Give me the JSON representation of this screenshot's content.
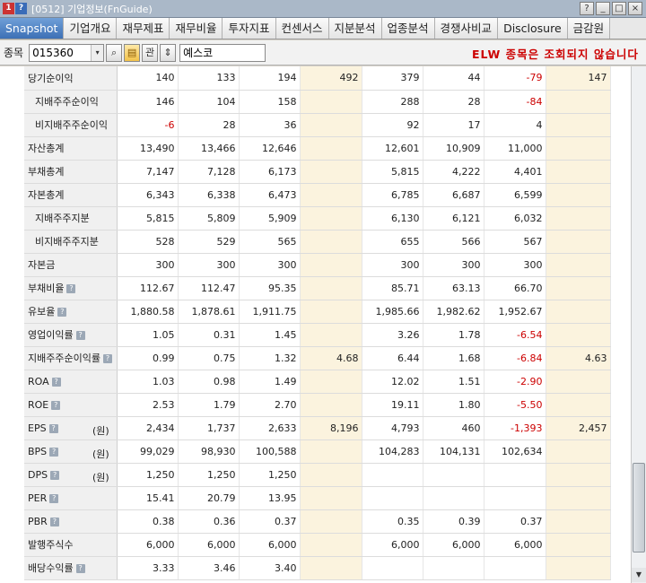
{
  "window": {
    "title": "[0512] 기업정보(FnGuide)",
    "icon_num": "1",
    "icon_q": "?",
    "btn_help": "?",
    "btn_minimize": "_",
    "btn_restore": "□",
    "btn_close": "×"
  },
  "tabs": [
    "Snapshot",
    "기업개요",
    "재무제표",
    "재무비율",
    "투자지표",
    "컨센서스",
    "지분분석",
    "업종분석",
    "경쟁사비교",
    "Disclosure",
    "금감원"
  ],
  "search": {
    "label": "종목",
    "code": "015360",
    "dropdown": "▾",
    "search_icon": "⌕",
    "folder_icon": "▤",
    "gwan": "관",
    "updown": "⇕",
    "name": "예스코"
  },
  "notice": "ELW 종목은 조회되지 않습니다",
  "help_glyph": "?",
  "rows": [
    {
      "label": "당기순이익",
      "sub": false,
      "help": false,
      "unit": "",
      "values": [
        "140",
        "133",
        "194",
        "492",
        "379",
        "44",
        "-79",
        "147"
      ]
    },
    {
      "label": "지배주주순이익",
      "sub": true,
      "help": false,
      "unit": "",
      "values": [
        "146",
        "104",
        "158",
        "",
        "288",
        "28",
        "-84",
        ""
      ]
    },
    {
      "label": "비지배주주순이익",
      "sub": true,
      "help": false,
      "unit": "",
      "values": [
        "-6",
        "28",
        "36",
        "",
        "92",
        "17",
        "4",
        ""
      ]
    },
    {
      "label": "자산총계",
      "sub": false,
      "help": false,
      "unit": "",
      "values": [
        "13,490",
        "13,466",
        "12,646",
        "",
        "12,601",
        "10,909",
        "11,000",
        ""
      ]
    },
    {
      "label": "부채총계",
      "sub": false,
      "help": false,
      "unit": "",
      "values": [
        "7,147",
        "7,128",
        "6,173",
        "",
        "5,815",
        "4,222",
        "4,401",
        ""
      ]
    },
    {
      "label": "자본총계",
      "sub": false,
      "help": false,
      "unit": "",
      "values": [
        "6,343",
        "6,338",
        "6,473",
        "",
        "6,785",
        "6,687",
        "6,599",
        ""
      ]
    },
    {
      "label": "지배주주지분",
      "sub": true,
      "help": false,
      "unit": "",
      "values": [
        "5,815",
        "5,809",
        "5,909",
        "",
        "6,130",
        "6,121",
        "6,032",
        ""
      ]
    },
    {
      "label": "비지배주주지분",
      "sub": true,
      "help": false,
      "unit": "",
      "values": [
        "528",
        "529",
        "565",
        "",
        "655",
        "566",
        "567",
        ""
      ]
    },
    {
      "label": "자본금",
      "sub": false,
      "help": false,
      "unit": "",
      "values": [
        "300",
        "300",
        "300",
        "",
        "300",
        "300",
        "300",
        ""
      ]
    },
    {
      "label": "부채비율",
      "sub": false,
      "help": true,
      "unit": "",
      "values": [
        "112.67",
        "112.47",
        "95.35",
        "",
        "85.71",
        "63.13",
        "66.70",
        ""
      ]
    },
    {
      "label": "유보율",
      "sub": false,
      "help": true,
      "unit": "",
      "values": [
        "1,880.58",
        "1,878.61",
        "1,911.75",
        "",
        "1,985.66",
        "1,982.62",
        "1,952.67",
        ""
      ]
    },
    {
      "label": "영업이익률",
      "sub": false,
      "help": true,
      "unit": "",
      "values": [
        "1.05",
        "0.31",
        "1.45",
        "",
        "3.26",
        "1.78",
        "-6.54",
        ""
      ]
    },
    {
      "label": "지배주주순이익률",
      "sub": false,
      "help": true,
      "unit": "",
      "values": [
        "0.99",
        "0.75",
        "1.32",
        "4.68",
        "6.44",
        "1.68",
        "-6.84",
        "4.63"
      ]
    },
    {
      "label": "ROA",
      "sub": false,
      "help": true,
      "unit": "",
      "values": [
        "1.03",
        "0.98",
        "1.49",
        "",
        "12.02",
        "1.51",
        "-2.90",
        ""
      ]
    },
    {
      "label": "ROE",
      "sub": false,
      "help": true,
      "unit": "",
      "values": [
        "2.53",
        "1.79",
        "2.70",
        "",
        "19.11",
        "1.80",
        "-5.50",
        ""
      ]
    },
    {
      "label": "EPS",
      "sub": false,
      "help": true,
      "unit": "(원)",
      "values": [
        "2,434",
        "1,737",
        "2,633",
        "8,196",
        "4,793",
        "460",
        "-1,393",
        "2,457"
      ]
    },
    {
      "label": "BPS",
      "sub": false,
      "help": true,
      "unit": "(원)",
      "values": [
        "99,029",
        "98,930",
        "100,588",
        "",
        "104,283",
        "104,131",
        "102,634",
        ""
      ]
    },
    {
      "label": "DPS",
      "sub": false,
      "help": true,
      "unit": "(원)",
      "values": [
        "1,250",
        "1,250",
        "1,250",
        "",
        "",
        "",
        "",
        ""
      ]
    },
    {
      "label": "PER",
      "sub": false,
      "help": true,
      "unit": "",
      "values": [
        "15.41",
        "20.79",
        "13.95",
        "",
        "",
        "",
        "",
        ""
      ]
    },
    {
      "label": "PBR",
      "sub": false,
      "help": true,
      "unit": "",
      "values": [
        "0.38",
        "0.36",
        "0.37",
        "",
        "0.35",
        "0.39",
        "0.37",
        ""
      ]
    },
    {
      "label": "발행주식수",
      "sub": false,
      "help": false,
      "unit": "",
      "values": [
        "6,000",
        "6,000",
        "6,000",
        "",
        "6,000",
        "6,000",
        "6,000",
        ""
      ]
    },
    {
      "label": "배당수익률",
      "sub": false,
      "help": true,
      "unit": "",
      "values": [
        "3.33",
        "3.46",
        "3.40",
        "",
        "",
        "",
        "",
        ""
      ]
    }
  ],
  "colors": {
    "highlight_col": "#fbf3de",
    "negative": "#cc0000",
    "active_tab": "#3b6eb4"
  }
}
